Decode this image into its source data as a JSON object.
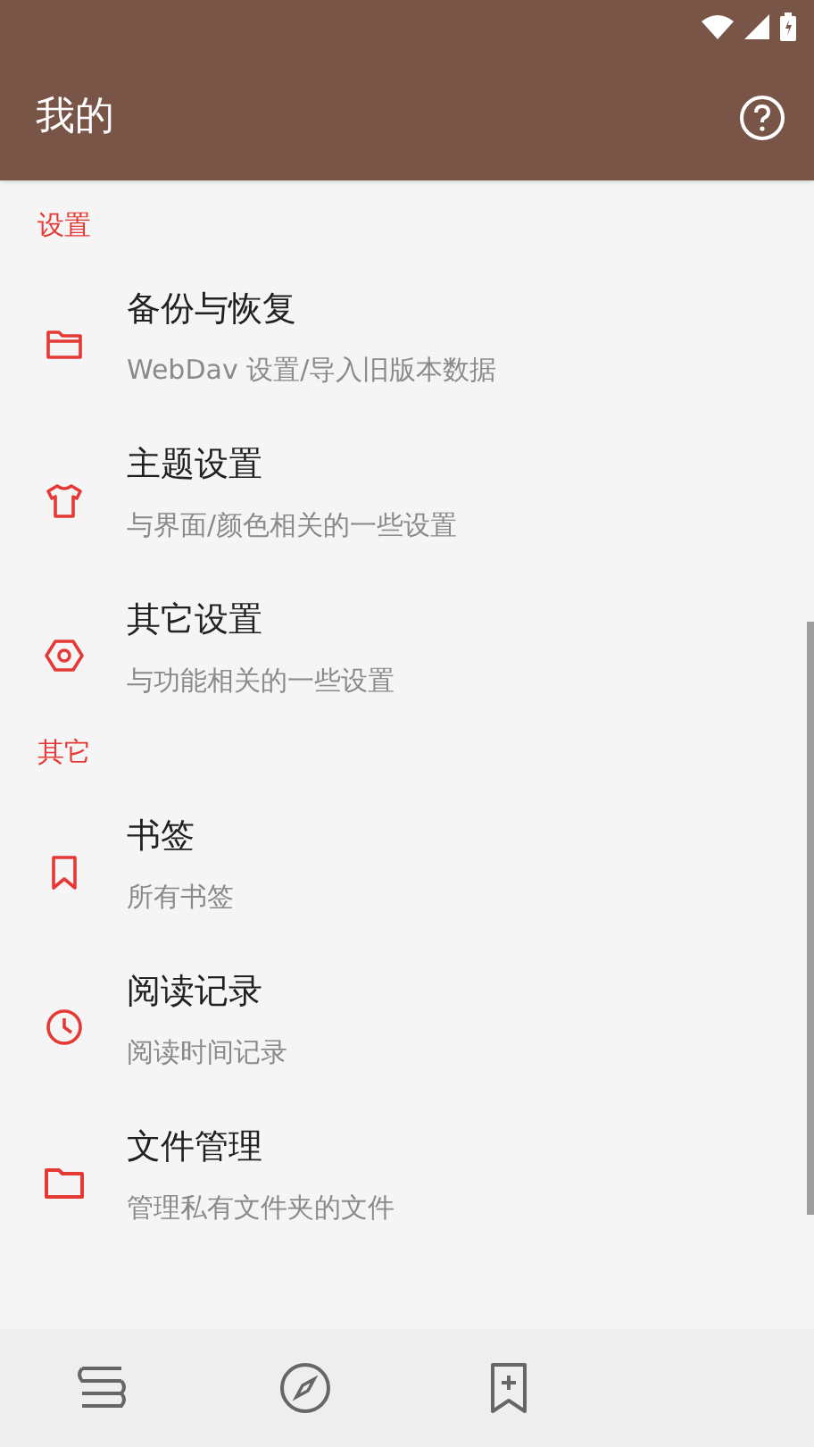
{
  "app_bar": {
    "title": "我的"
  },
  "sections": [
    {
      "header": "设置",
      "items": [
        {
          "kind": "folder",
          "title": "备份与恢复",
          "subtitle": "WebDav 设置/导入旧版本数据"
        },
        {
          "kind": "shirt",
          "title": "主题设置",
          "subtitle": "与界面/颜色相关的一些设置"
        },
        {
          "kind": "hexagon",
          "title": "其它设置",
          "subtitle": "与功能相关的一些设置"
        }
      ]
    },
    {
      "header": "其它",
      "items": [
        {
          "kind": "bookmark",
          "title": "书签",
          "subtitle": "所有书签"
        },
        {
          "kind": "clock",
          "title": "阅读记录",
          "subtitle": "阅读时间记录"
        },
        {
          "kind": "folder-solid",
          "title": "文件管理",
          "subtitle": "管理私有文件夹的文件"
        }
      ]
    }
  ],
  "bottom_nav": [
    {
      "kind": "bookshelf"
    },
    {
      "kind": "compass"
    },
    {
      "kind": "bookmark-add"
    }
  ]
}
